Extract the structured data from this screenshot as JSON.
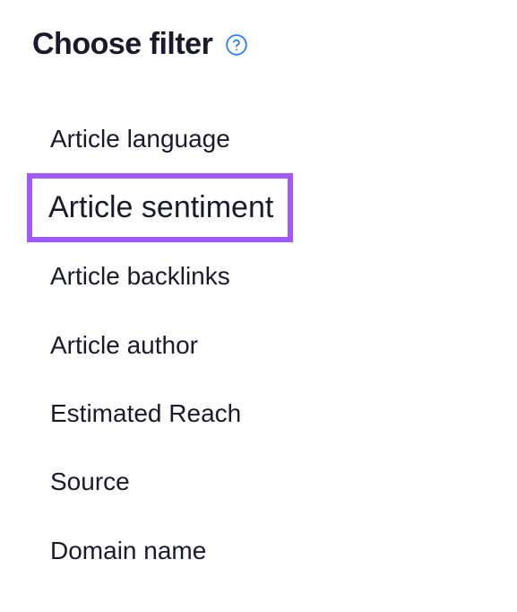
{
  "header": {
    "title": "Choose filter"
  },
  "filters": {
    "items": [
      {
        "label": "Article language"
      },
      {
        "label": "Article sentiment"
      },
      {
        "label": "Article backlinks"
      },
      {
        "label": "Article author"
      },
      {
        "label": "Estimated Reach"
      },
      {
        "label": "Source"
      },
      {
        "label": "Domain name"
      }
    ]
  },
  "icons": {
    "help": "help-circle-icon"
  },
  "colors": {
    "highlight": "#a259ff",
    "help_icon": "#1e7dff"
  }
}
